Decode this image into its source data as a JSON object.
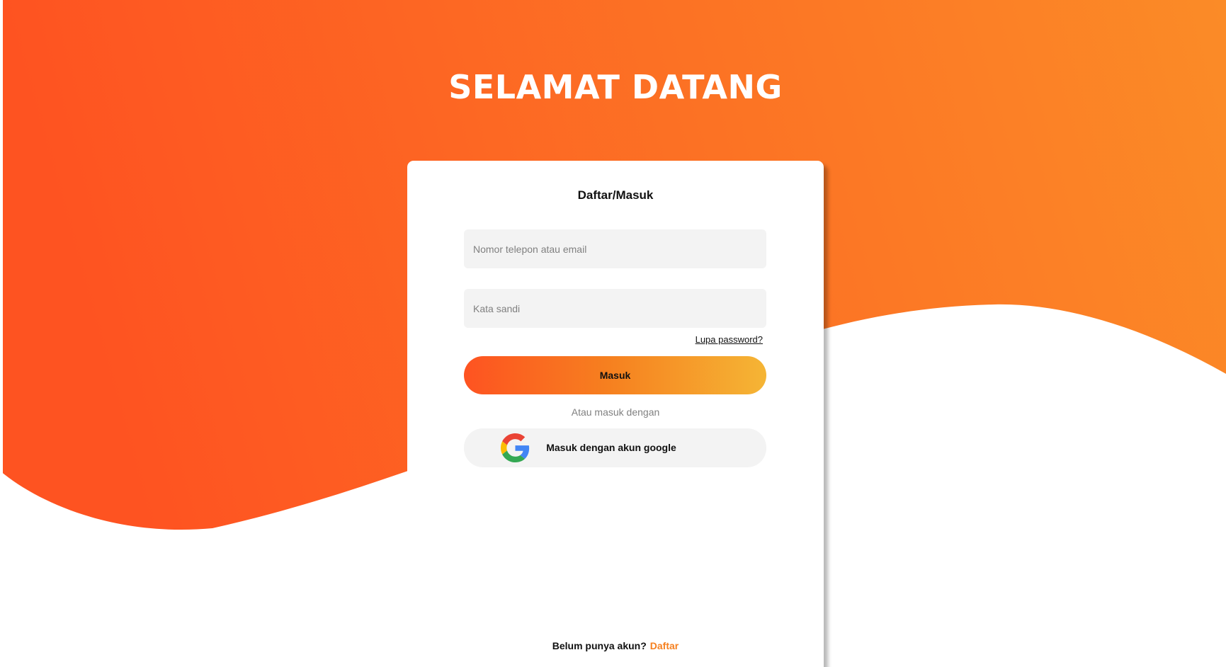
{
  "hero": {
    "title": "SELAMAT DATANG"
  },
  "login_card": {
    "title": "Daftar/Masuk",
    "identifier_field": {
      "placeholder": "Nomor telepon atau email",
      "value": ""
    },
    "password_field": {
      "placeholder": "Kata sandi",
      "value": ""
    },
    "forgot_password_label": "Lupa password?",
    "submit_label": "Masuk",
    "alternative_text": "Atau masuk dengan",
    "google_button_label": "Masuk dengan akun google",
    "signup_prompt": "Belum punya akun?",
    "signup_link_label": "Daftar"
  },
  "icons": {
    "google": "google-logo-icon"
  },
  "colors": {
    "gradient_start": "#fe5321",
    "gradient_mid": "#f6801f",
    "gradient_end": "#f5b535",
    "signup_link": "#f6801f",
    "field_background": "#f3f3f3",
    "card_background": "#ffffff"
  }
}
